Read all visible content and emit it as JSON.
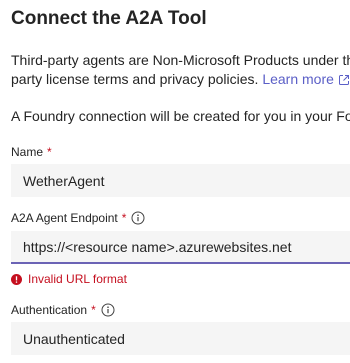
{
  "page": {
    "title": "Connect the A2A Tool",
    "disclaimer_line1": "Third-party agents are Non-Microsoft Products under the",
    "disclaimer_line2": "party license terms and privacy policies.",
    "learn_more_label": "Learn more",
    "foundry_note": "A Foundry connection will be created for you in your Four"
  },
  "form": {
    "name": {
      "label": "Name",
      "required_mark": "*",
      "value": "WetherAgent"
    },
    "endpoint": {
      "label": "A2A Agent Endpoint",
      "required_mark": "*",
      "value": "https://<resource name>.azurewebsites.net",
      "error": "Invalid URL format",
      "info_icon": "info-icon"
    },
    "authentication": {
      "label": "Authentication",
      "required_mark": "*",
      "value": "Unauthenticated",
      "info_icon": "info-icon"
    }
  },
  "colors": {
    "link": "#5b5fc7",
    "error": "#c50f1f",
    "field_bg": "#f5f5f5",
    "invalid_underline": "#6b63b5"
  }
}
